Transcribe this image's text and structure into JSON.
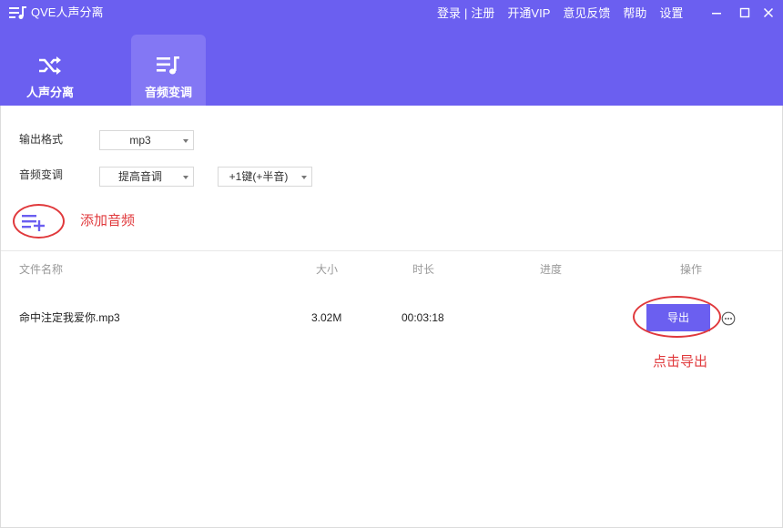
{
  "app": {
    "title": "QVE人声分离",
    "logo_icon": "music-list-icon"
  },
  "top_links": {
    "login": "登录",
    "separator": "|",
    "register": "注册",
    "vip": "开通VIP",
    "feedback": "意见反馈",
    "help": "帮助",
    "settings": "设置"
  },
  "window_controls": {
    "minimize_icon": "minimize-icon",
    "maximize_icon": "maximize-icon",
    "close_icon": "close-icon"
  },
  "tabs": [
    {
      "label": "人声分离",
      "icon": "shuffle-icon",
      "active": false
    },
    {
      "label": "音频变调",
      "icon": "music-note-list-icon",
      "active": true
    }
  ],
  "settings": {
    "output_format": {
      "label": "输出格式",
      "value": "mp3"
    },
    "pitch": {
      "label": "音频变调",
      "mode": "提高音调",
      "amount": "+1键(+半音)"
    }
  },
  "add_audio": {
    "label": "添加音频",
    "icon": "add-list-icon"
  },
  "table": {
    "headers": {
      "name": "文件名称",
      "size": "大小",
      "duration": "时长",
      "progress": "进度",
      "action": "操作"
    },
    "rows": [
      {
        "name": "命中注定我爱你.mp3",
        "size": "3.02M",
        "duration": "00:03:18",
        "progress": "",
        "action_label": "导出"
      }
    ]
  },
  "annotations": {
    "export_hint": "点击导出"
  },
  "colors": {
    "brand": "#6b5ff0",
    "tab_active": "#8377f4",
    "annotation": "#e0393c"
  }
}
